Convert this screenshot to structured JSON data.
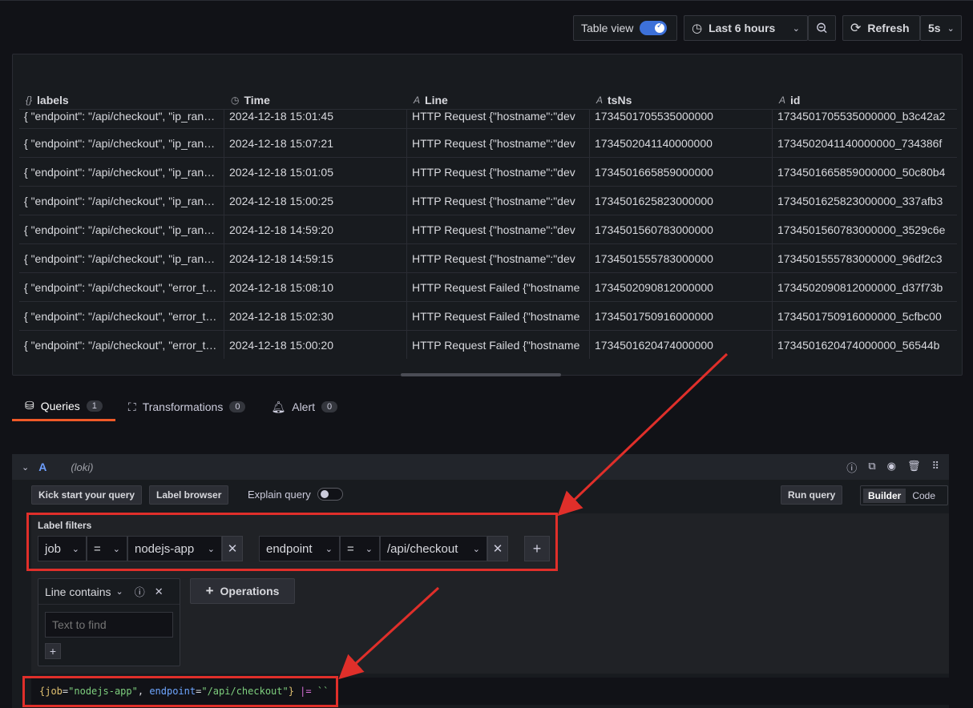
{
  "toolbar": {
    "table_view_label": "Table view",
    "time_range": "Last 6 hours",
    "refresh_label": "Refresh",
    "refresh_interval": "5s"
  },
  "table": {
    "columns": [
      {
        "icon": "{}",
        "label": "labels"
      },
      {
        "icon": "◷",
        "label": "Time"
      },
      {
        "icon": "A",
        "label": "Line"
      },
      {
        "icon": "A",
        "label": "tsNs"
      },
      {
        "icon": "A",
        "label": "id"
      }
    ],
    "rows": [
      [
        "{ \"endpoint\": \"/api/checkout\", \"ip_ran…",
        "2024-12-18 15:01:45",
        "HTTP Request {\"hostname\":\"dev",
        "1734501705535000000",
        "1734501705535000000_b3c42a2"
      ],
      [
        "{ \"endpoint\": \"/api/checkout\", \"ip_ran…",
        "2024-12-18 15:07:21",
        "HTTP Request {\"hostname\":\"dev",
        "1734502041140000000",
        "1734502041140000000_734386f"
      ],
      [
        "{ \"endpoint\": \"/api/checkout\", \"ip_ran…",
        "2024-12-18 15:01:05",
        "HTTP Request {\"hostname\":\"dev",
        "1734501665859000000",
        "1734501665859000000_50c80b4"
      ],
      [
        "{ \"endpoint\": \"/api/checkout\", \"ip_ran…",
        "2024-12-18 15:00:25",
        "HTTP Request {\"hostname\":\"dev",
        "1734501625823000000",
        "1734501625823000000_337afb3"
      ],
      [
        "{ \"endpoint\": \"/api/checkout\", \"ip_ran…",
        "2024-12-18 14:59:20",
        "HTTP Request {\"hostname\":\"dev",
        "1734501560783000000",
        "1734501560783000000_3529c6e"
      ],
      [
        "{ \"endpoint\": \"/api/checkout\", \"ip_ran…",
        "2024-12-18 14:59:15",
        "HTTP Request {\"hostname\":\"dev",
        "1734501555783000000",
        "1734501555783000000_96df2c3"
      ],
      [
        "{ \"endpoint\": \"/api/checkout\", \"error_t…",
        "2024-12-18 15:08:10",
        "HTTP Request Failed {\"hostname",
        "1734502090812000000",
        "1734502090812000000_d37f73b"
      ],
      [
        "{ \"endpoint\": \"/api/checkout\", \"error_t…",
        "2024-12-18 15:02:30",
        "HTTP Request Failed {\"hostname",
        "1734501750916000000",
        "1734501750916000000_5cfbc00"
      ],
      [
        "{ \"endpoint\": \"/api/checkout\", \"error_t…",
        "2024-12-18 15:00:20",
        "HTTP Request Failed {\"hostname",
        "1734501620474000000",
        "1734501620474000000_56544b"
      ]
    ]
  },
  "tabs": [
    {
      "label": "Queries",
      "count": "1"
    },
    {
      "label": "Transformations",
      "count": "0"
    },
    {
      "label": "Alert",
      "count": "0"
    }
  ],
  "query": {
    "letter": "A",
    "datasource": "(loki)",
    "kick_start": "Kick start your query",
    "label_browser": "Label browser",
    "explain": "Explain query",
    "run_query": "Run query",
    "builder": "Builder",
    "code": "Code",
    "label_filters_title": "Label filters",
    "filter1": {
      "label": "job",
      "op": "=",
      "value": "nodejs-app"
    },
    "filter2": {
      "label": "endpoint",
      "op": "=",
      "value": "/api/checkout"
    },
    "line_contains": "Line contains",
    "text_placeholder": "Text to find",
    "operations": "Operations",
    "logql": {
      "open": "{",
      "k1": "job",
      "v1": "\"nodejs-app\"",
      "sep": ", ",
      "k2": "endpoint",
      "v2": "\"/api/checkout\"",
      "close": "}",
      "pipe": " |= ",
      "str": "``"
    }
  },
  "colors": {
    "accent_blue": "#3d71d9",
    "annotation_red": "#e02f2a",
    "tab_active": "#f05a28"
  }
}
